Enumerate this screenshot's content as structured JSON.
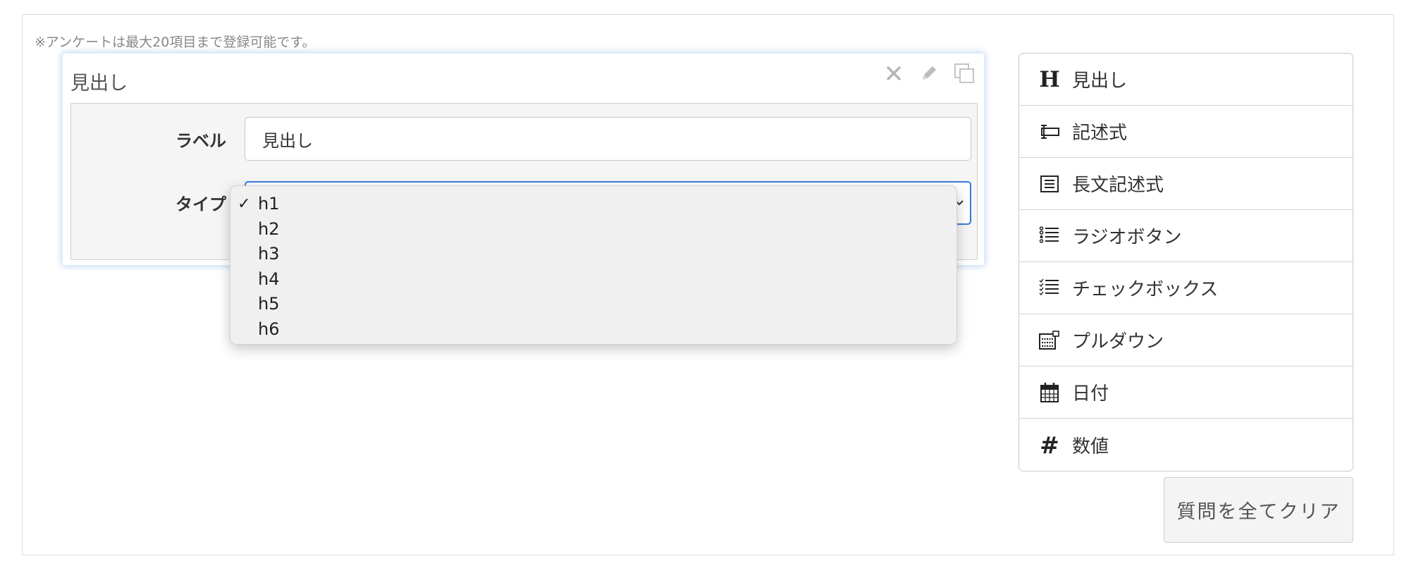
{
  "note": "※アンケートは最大20項目まで登録可能です。",
  "question_card": {
    "title": "見出し",
    "actions": {
      "delete_icon": "close-icon",
      "edit_icon": "pencil-icon",
      "copy_icon": "copy-icon"
    },
    "label_field": {
      "label": "ラベル",
      "value": "見出し"
    },
    "type_field": {
      "label": "タイプ",
      "selected": "h1",
      "options": [
        "h1",
        "h2",
        "h3",
        "h4",
        "h5",
        "h6"
      ],
      "checkmark": "✓"
    }
  },
  "palette": {
    "items": [
      {
        "label": "見出し",
        "icon": "heading-icon",
        "glyph": "H"
      },
      {
        "label": "記述式",
        "icon": "text-input-icon"
      },
      {
        "label": "長文記述式",
        "icon": "textarea-icon"
      },
      {
        "label": "ラジオボタン",
        "icon": "radio-list-icon"
      },
      {
        "label": "チェックボックス",
        "icon": "checkbox-list-icon"
      },
      {
        "label": "プルダウン",
        "icon": "dropdown-icon"
      },
      {
        "label": "日付",
        "icon": "calendar-icon"
      },
      {
        "label": "数値",
        "icon": "hash-icon",
        "glyph": "#"
      }
    ]
  },
  "clear_button": {
    "label": "質問を全てクリア"
  },
  "colors": {
    "accent": "#3a7bd5",
    "card_glow": "#6ea5e6"
  }
}
